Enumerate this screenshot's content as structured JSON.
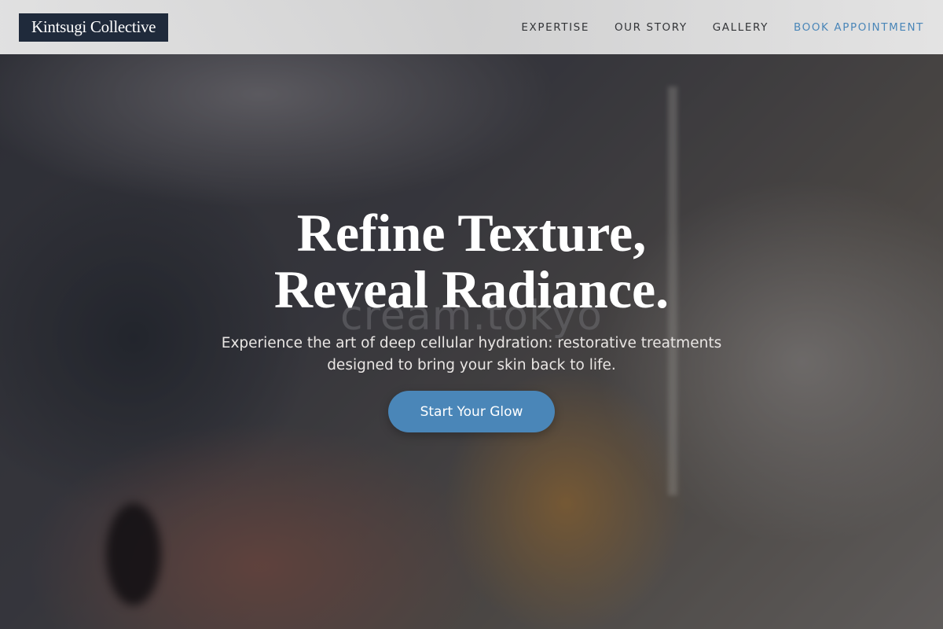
{
  "header": {
    "brand": "Kintsugi Collective",
    "nav": [
      {
        "label": "EXPERTISE"
      },
      {
        "label": "OUR STORY"
      },
      {
        "label": "GALLERY"
      },
      {
        "label": "BOOK APPOINTMENT"
      }
    ],
    "accent_color": "#4a86b8",
    "brand_bg_color": "#1f2a3b"
  },
  "hero": {
    "headline_line1": "Refine Texture,",
    "headline_line2": "Reveal Radiance.",
    "watermark": "cream.tokyo",
    "subtext_line1": "Experience the art of deep cellular hydration: restorative treatments",
    "subtext_line2": "designed to bring your skin back to life.",
    "cta_label": "Start Your Glow"
  }
}
